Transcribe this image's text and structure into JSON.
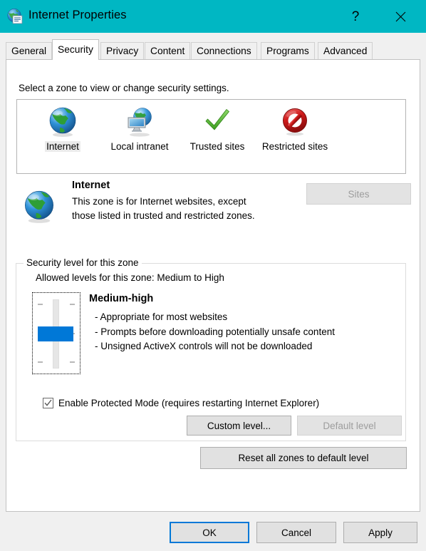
{
  "window": {
    "title": "Internet Properties",
    "icon": "internet-properties-icon",
    "titlebar_color": "#00b7c3",
    "help_label": "?",
    "close_label": "✕"
  },
  "tabs": [
    {
      "label": "General",
      "active": false
    },
    {
      "label": "Security",
      "active": true
    },
    {
      "label": "Privacy",
      "active": false
    },
    {
      "label": "Content",
      "active": false
    },
    {
      "label": "Connections",
      "active": false
    },
    {
      "label": "Programs",
      "active": false
    },
    {
      "label": "Advanced",
      "active": false
    }
  ],
  "security": {
    "lead_text": "Select a zone to view or change security settings.",
    "zones": [
      {
        "label": "Internet",
        "icon": "globe-icon",
        "selected": true
      },
      {
        "label": "Local intranet",
        "icon": "monitor-globe-icon",
        "selected": false
      },
      {
        "label": "Trusted sites",
        "icon": "green-check-icon",
        "selected": false
      },
      {
        "label": "Restricted sites",
        "icon": "red-prohibited-icon",
        "selected": false
      }
    ],
    "zone_detail": {
      "icon": "globe-icon",
      "title": "Internet",
      "description": "This zone is for Internet websites, except those listed in trusted and restricted zones.",
      "sites_button": "Sites",
      "sites_button_enabled": false
    },
    "level_group": {
      "legend": "Security level for this zone",
      "allowed_levels": "Allowed levels for this zone: Medium to High",
      "slider": {
        "accent_color": "#0078d7",
        "position_percent": 50,
        "tick_count": 4,
        "focused": true
      },
      "level_name": "Medium-high",
      "level_bullets": [
        "- Appropriate for most websites",
        "- Prompts before downloading potentially unsafe content",
        "- Unsigned ActiveX controls will not be downloaded"
      ],
      "protected_mode": {
        "label": "Enable Protected Mode (requires restarting Internet Explorer)",
        "checked": true
      },
      "custom_level_button": "Custom level...",
      "custom_level_enabled": true,
      "default_level_button": "Default level",
      "default_level_enabled": false
    },
    "reset_button": "Reset all zones to default level"
  },
  "footer": {
    "ok": "OK",
    "cancel": "Cancel",
    "apply": "Apply",
    "default_button": "OK",
    "focus_color": "#0078d7"
  }
}
